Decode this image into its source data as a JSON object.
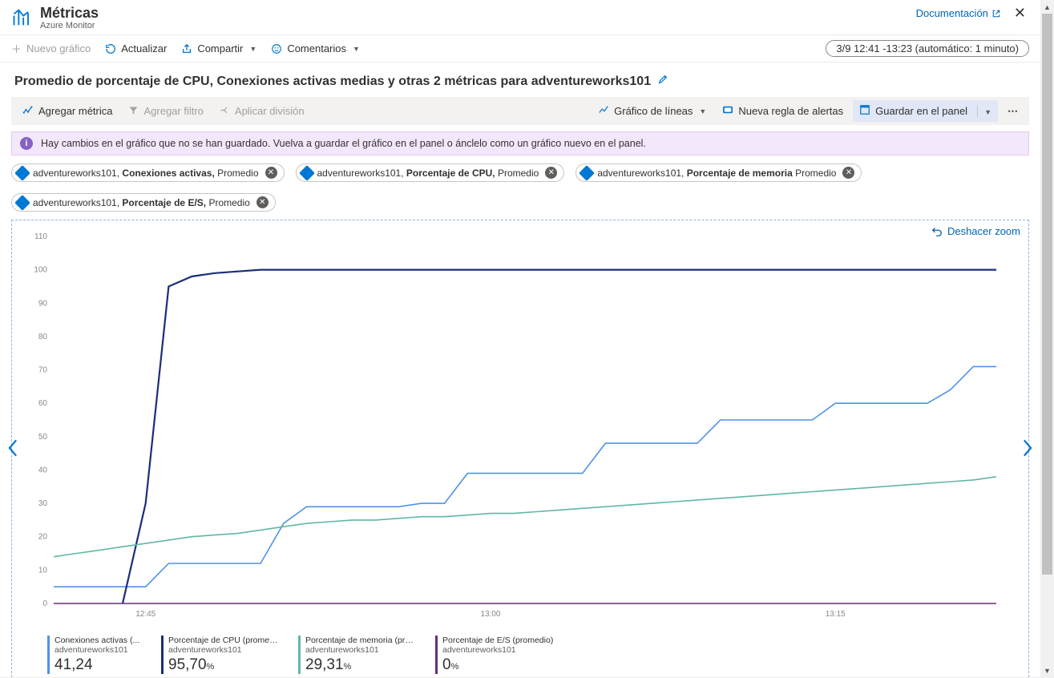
{
  "header": {
    "title": "Métricas",
    "subtitle": "Azure Monitor",
    "doc_link": "Documentación",
    "toolbar": {
      "new_chart": "Nuevo gráfico",
      "refresh": "Actualizar",
      "share": "Compartir",
      "feedback": "Comentarios"
    },
    "time_range": "3/9 12:41 -13:23 (automático: 1 minuto)"
  },
  "chart_title": "Promedio de porcentaje de CPU, Conexiones activas medias y otras 2 métricas para adventureworks101",
  "toolbar2": {
    "add_metric": "Agregar métrica",
    "add_filter": "Agregar filtro",
    "apply_split": "Aplicar división",
    "chart_type": "Gráfico de líneas",
    "new_alert": "Nueva regla de alertas",
    "pin": "Guardar en el panel"
  },
  "notice": "Hay cambios en el gráfico que no se han guardado. Vuelva a guardar el gráfico en el panel o ánclelo como un gráfico nuevo en el panel.",
  "pills": [
    {
      "resource": "adventureworks101",
      "metric": "Conexiones activas,",
      "agg": "Promedio"
    },
    {
      "resource": "adventureworks101",
      "metric": "Porcentaje de CPU,",
      "agg": "Promedio"
    },
    {
      "resource": "adventureworks101",
      "metric": "Porcentaje de memoria",
      "agg": "Promedio"
    },
    {
      "resource": "adventureworks101",
      "metric": "Porcentaje de E/S,",
      "agg": "Promedio"
    }
  ],
  "undo_zoom": "Deshacer zoom",
  "legend": [
    {
      "color": "#4f93e6",
      "label": "Conexiones activas (...",
      "sub": "adventureworks101",
      "value": "41,24",
      "unit": ""
    },
    {
      "color": "#1a2e7b",
      "label": "Porcentaje de CPU (promedio)",
      "sub": "adventureworks101",
      "value": "95,70",
      "unit": "%"
    },
    {
      "color": "#5fb8a5",
      "label": "Porcentaje de memoria (promedio)",
      "sub": "adventureworks101",
      "value": "29,31",
      "unit": "%"
    },
    {
      "color": "#6b2d7a",
      "label": "Porcentaje de E/S (promedio)",
      "sub": "adventureworks101",
      "value": "0",
      "unit": "%"
    }
  ],
  "chart_data": {
    "type": "line",
    "xlabel": "",
    "ylabel": "",
    "x_ticks": [
      "12:45",
      "13:00",
      "13:15"
    ],
    "ylim": [
      0,
      110
    ],
    "y_ticks": [
      0,
      10,
      20,
      30,
      40,
      50,
      60,
      70,
      80,
      90,
      100,
      110
    ],
    "x": [
      0,
      1,
      2,
      3,
      4,
      5,
      6,
      7,
      8,
      9,
      10,
      11,
      12,
      13,
      14,
      15,
      16,
      17,
      18,
      19,
      20,
      21,
      22,
      23,
      24,
      25,
      26,
      27,
      28,
      29,
      30,
      31,
      32,
      33,
      34,
      35,
      36,
      37,
      38,
      39,
      40,
      41
    ],
    "series": [
      {
        "name": "Conexiones activas (promedio)",
        "color": "#4f93e6",
        "values": [
          5,
          5,
          5,
          5,
          5,
          12,
          12,
          12,
          12,
          12,
          24,
          29,
          29,
          29,
          29,
          29,
          30,
          30,
          39,
          39,
          39,
          39,
          39,
          39,
          48,
          48,
          48,
          48,
          48,
          55,
          55,
          55,
          55,
          55,
          60,
          60,
          60,
          60,
          60,
          64,
          71,
          71
        ]
      },
      {
        "name": "Porcentaje de CPU (promedio)",
        "color": "#1a2e7b",
        "values": [
          null,
          null,
          null,
          0,
          30,
          95,
          98,
          99,
          99.5,
          100,
          100,
          100,
          100,
          100,
          100,
          100,
          100,
          100,
          100,
          100,
          100,
          100,
          100,
          100,
          100,
          100,
          100,
          100,
          100,
          100,
          100,
          100,
          100,
          100,
          100,
          100,
          100,
          100,
          100,
          100,
          100,
          100
        ]
      },
      {
        "name": "Porcentaje de memoria (promedio)",
        "color": "#5fb8a5",
        "values": [
          14,
          15,
          16,
          17,
          18,
          19,
          20,
          20.5,
          21,
          22,
          23,
          24,
          24.5,
          25,
          25,
          25.5,
          26,
          26,
          26.5,
          27,
          27,
          27.5,
          28,
          28.5,
          29,
          29.5,
          30,
          30.5,
          31,
          31.5,
          32,
          32.5,
          33,
          33.5,
          34,
          34.5,
          35,
          35.5,
          36,
          36.5,
          37,
          38
        ]
      },
      {
        "name": "Porcentaje de E/S (promedio)",
        "color": "#6b2d7a",
        "values": [
          0,
          0,
          0,
          0,
          0,
          0,
          0,
          0,
          0,
          0,
          0,
          0,
          0,
          0,
          0,
          0,
          0,
          0,
          0,
          0,
          0,
          0,
          0,
          0,
          0,
          0,
          0,
          0,
          0,
          0,
          0,
          0,
          0,
          0,
          0,
          0,
          0,
          0,
          0,
          0,
          0,
          0
        ]
      }
    ]
  }
}
